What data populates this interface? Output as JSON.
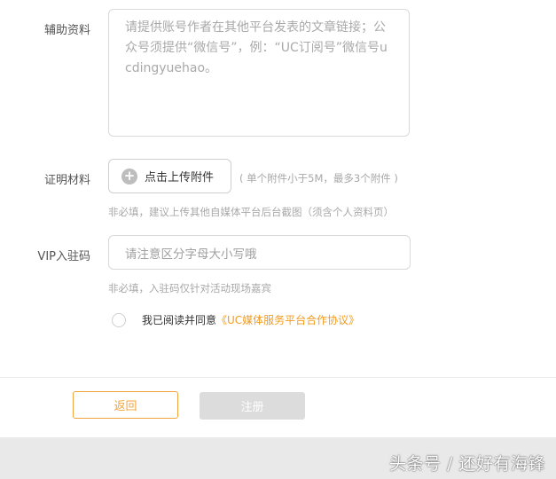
{
  "form": {
    "aux_label": "辅助资料",
    "aux_placeholder": "请提供账号作者在其他平台发表的文章链接；公众号须提供“微信号”，例：“UC订阅号”微信号ucdingyuehao。",
    "proof_label": "证明材料",
    "upload_label": "点击上传附件",
    "upload_hint": "( 单个附件小于5M，最多3个附件 )",
    "proof_hint": "非必填，建议上传其他自媒体平台后台截图（须含个人资料页）",
    "vip_label": "VIP入驻码",
    "vip_placeholder": "请注意区分字母大小写哦",
    "vip_hint": "非必填，入驻码仅针对活动现场嘉宾",
    "agree_prefix": "我已阅读并同意",
    "agree_link": "《UC媒体服务平台合作协议》"
  },
  "actions": {
    "back_label": "返回",
    "register_label": "注册"
  },
  "watermark": "头条号 / 还好有海锋",
  "colors": {
    "accent": "#f29b21",
    "disabled": "#dcdcdc"
  }
}
